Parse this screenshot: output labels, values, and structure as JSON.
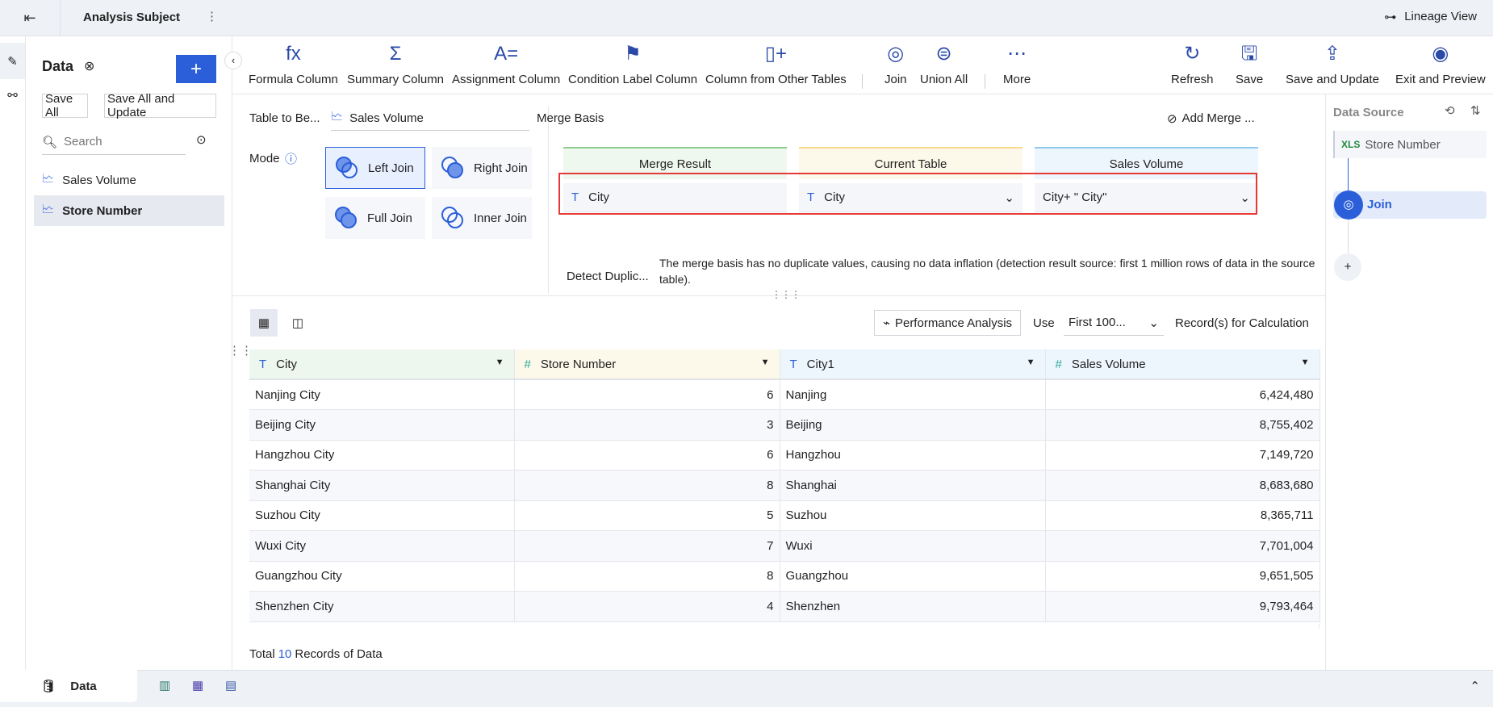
{
  "header": {
    "title": "Analysis Subject",
    "lineage_view": "Lineage View"
  },
  "left": {
    "title": "Data",
    "add": "+",
    "save_all": "Save All",
    "save_all_update": "Save All and Update",
    "search_placeholder": "Search",
    "items": [
      {
        "label": "Sales Volume"
      },
      {
        "label": "Store Number"
      }
    ]
  },
  "toolbar": {
    "items": [
      {
        "label": "Formula Column",
        "icon": "fx"
      },
      {
        "label": "Summary Column",
        "icon": "Σ"
      },
      {
        "label": "Assignment Column",
        "icon": "A="
      },
      {
        "label": "Condition Label Column",
        "icon": "⚑"
      },
      {
        "label": "Column from Other Tables",
        "icon": "▯+"
      },
      {
        "label": "Join",
        "icon": "◎"
      },
      {
        "label": "Union All",
        "icon": "⊜"
      },
      {
        "label": "More",
        "icon": "⋯"
      },
      {
        "label": "Refresh",
        "icon": "↻"
      },
      {
        "label": "Save",
        "icon": "🖫"
      },
      {
        "label": "Save and Update",
        "icon": "⇪"
      },
      {
        "label": "Exit and Preview",
        "icon": "◉"
      }
    ]
  },
  "config": {
    "table_label": "Table to Be...",
    "table_value": "Sales Volume",
    "mode_label": "Mode",
    "modes": [
      "Left Join",
      "Right Join",
      "Full Join",
      "Inner Join"
    ],
    "merge_basis": "Merge Basis",
    "add_merge": "Add Merge ...",
    "headers": [
      "Merge Result",
      "Current Table",
      "Sales Volume"
    ],
    "values": [
      "City",
      "City",
      "City+ \" City\""
    ],
    "detect_label": "Detect Duplic...",
    "detect_text": "The merge basis has no duplicate values, causing no data inflation (detection result source: first 1 million rows of data in the source table)."
  },
  "grid": {
    "perf": "Performance Analysis",
    "use": "Use",
    "first": "First 100...",
    "records_calc": "Record(s) for Calculation",
    "columns": [
      {
        "name": "City",
        "type": "T"
      },
      {
        "name": "Store Number",
        "type": "#"
      },
      {
        "name": "City1",
        "type": "T"
      },
      {
        "name": "Sales Volume",
        "type": "#"
      }
    ],
    "rows": [
      [
        "Nanjing City",
        "6",
        "Nanjing",
        "6,424,480"
      ],
      [
        "Beijing City",
        "3",
        "Beijing",
        "8,755,402"
      ],
      [
        "Hangzhou City",
        "6",
        "Hangzhou",
        "7,149,720"
      ],
      [
        "Shanghai City",
        "8",
        "Shanghai",
        "8,683,680"
      ],
      [
        "Suzhou City",
        "5",
        "Suzhou",
        "8,365,711"
      ],
      [
        "Wuxi City",
        "7",
        "Wuxi",
        "7,701,004"
      ],
      [
        "Guangzhou City",
        "8",
        "Guangzhou",
        "9,651,505"
      ],
      [
        "Shenzhen City",
        "4",
        "Shenzhen",
        "9,793,464"
      ]
    ],
    "total_pre": "Total",
    "total_count": "10",
    "total_post": "Records of Data"
  },
  "right": {
    "title": "Data Source",
    "source": "Store Number",
    "xls": "XLS",
    "join": "Join",
    "add": "+"
  },
  "bottom": {
    "tab": "Data"
  }
}
